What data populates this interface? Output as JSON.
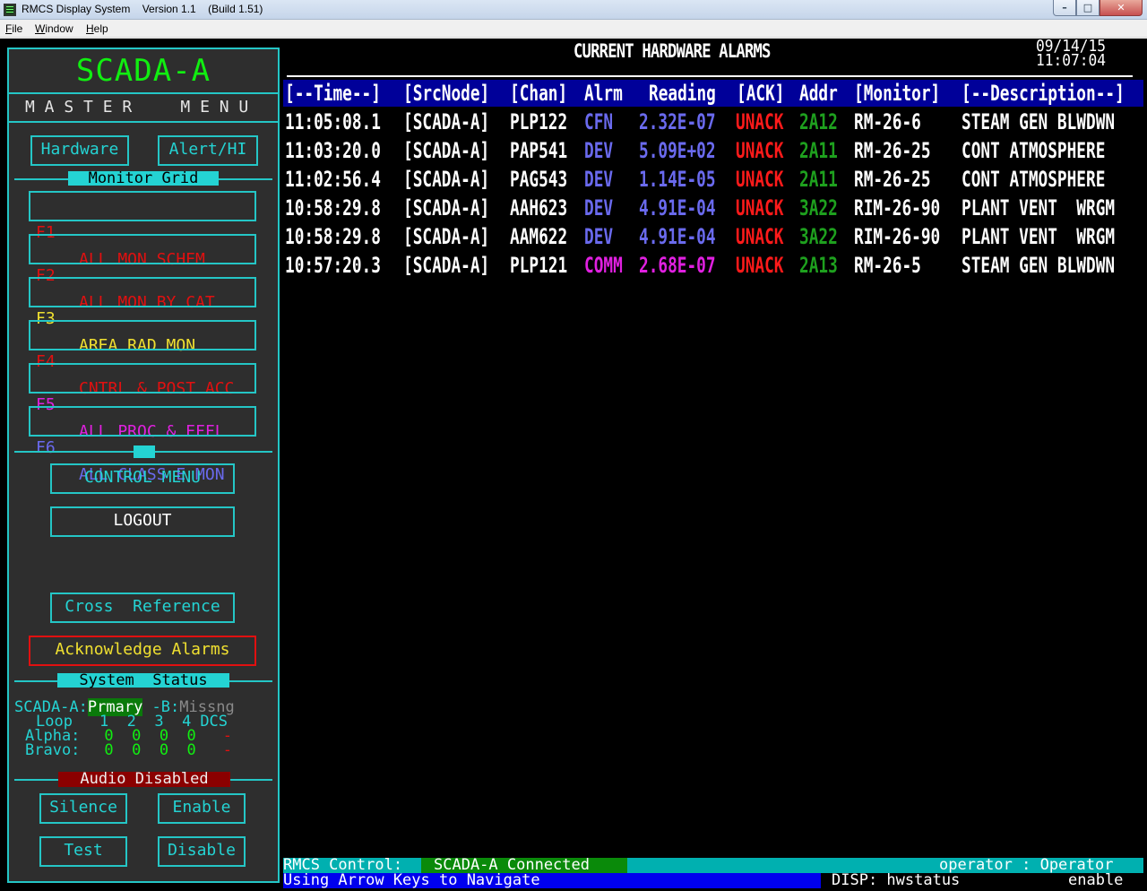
{
  "window": {
    "title": "RMCS Display System    Version 1.1    (Build 1.51)",
    "minimize": "–",
    "maximize": "□",
    "close": "✕"
  },
  "menubar": {
    "file": {
      "hot": "F",
      "rest": "ile"
    },
    "window": {
      "hot": "W",
      "rest": "indow"
    },
    "help": {
      "hot": "H",
      "rest": "elp"
    }
  },
  "panel": {
    "title": "SCADA-A",
    "master_menu": "M A S T E R     M E N U",
    "hardware": "Hardware",
    "alert_hi": "Alert/HI",
    "monitor_grid": "Monitor Grid",
    "fkeys": [
      {
        "key": "F1",
        "label": "ALL MON SCHEM",
        "color": "#e11010"
      },
      {
        "key": "F2",
        "label": "ALL MON BY CAT",
        "color": "#e11010"
      },
      {
        "key": "F3",
        "label": "AREA RAD MON",
        "color": "#f0e030"
      },
      {
        "key": "F4",
        "label": "CNTRL & POST ACC",
        "color": "#e11010"
      },
      {
        "key": "F5",
        "label": "ALL PROC & EFFL",
        "color": "#e020e0"
      },
      {
        "key": "F6",
        "label": "ALL CLASS E MON",
        "color": "#6a6aee"
      }
    ],
    "control_menu": "CONTROL MENU",
    "logout": "LOGOUT",
    "cross_reference": "Cross  Reference",
    "acknowledge_alarms": "Acknowledge Alarms",
    "system_status": "System  Status",
    "status": {
      "scada_a_label": "SCADA-A:",
      "scada_a_value": "Prmary",
      "scada_b_label": " -B:",
      "scada_b_value": "Missng",
      "loop_label": "Loop",
      "loop_cols": "1  2  3  4",
      "dcs_label": "DCS",
      "alpha_label": "Alpha:",
      "alpha_values": "0  0  0  0",
      "alpha_dcs": "-",
      "bravo_label": "Bravo:",
      "bravo_values": "0  0  0  0",
      "bravo_dcs": "-"
    },
    "audio": "Audio Disabled",
    "silence": "Silence",
    "enable": "Enable",
    "test": "Test",
    "disable": "Disable"
  },
  "alarms": {
    "title": "CURRENT HARDWARE ALARMS",
    "date": "09/14/15",
    "time": "11:07:04",
    "columns": [
      "[--Time--]",
      "[SrcNode]",
      "[Chan]",
      "Alrm",
      "Reading",
      "[ACK]",
      "Addr",
      "[Monitor]",
      "[--Description--]"
    ],
    "rows": [
      {
        "time": "11:05:08.1",
        "node": "[SCADA-A]",
        "chan": "PLP122",
        "alrm": "CFN",
        "reading": "2.32E-07",
        "ack": "UNACK",
        "addr": "2A12",
        "monitor": "RM-26-6",
        "desc": "STEAM GEN BLWDWN",
        "alrm_color": "#6a6aee",
        "reading_color": "#6a6aee"
      },
      {
        "time": "11:03:20.0",
        "node": "[SCADA-A]",
        "chan": "PAP541",
        "alrm": "DEV",
        "reading": "5.09E+02",
        "ack": "UNACK",
        "addr": "2A11",
        "monitor": "RM-26-25",
        "desc": "CONT ATMOSPHERE",
        "alrm_color": "#6a6aee",
        "reading_color": "#6a6aee"
      },
      {
        "time": "11:02:56.4",
        "node": "[SCADA-A]",
        "chan": "PAG543",
        "alrm": "DEV",
        "reading": "1.14E-05",
        "ack": "UNACK",
        "addr": "2A11",
        "monitor": "RM-26-25",
        "desc": "CONT ATMOSPHERE",
        "alrm_color": "#6a6aee",
        "reading_color": "#6a6aee"
      },
      {
        "time": "10:58:29.8",
        "node": "[SCADA-A]",
        "chan": "AAH623",
        "alrm": "DEV",
        "reading": "4.91E-04",
        "ack": "UNACK",
        "addr": "3A22",
        "monitor": "RIM-26-90",
        "desc": "PLANT VENT  WRGM",
        "alrm_color": "#6a6aee",
        "reading_color": "#6a6aee"
      },
      {
        "time": "10:58:29.8",
        "node": "[SCADA-A]",
        "chan": "AAM622",
        "alrm": "DEV",
        "reading": "4.91E-04",
        "ack": "UNACK",
        "addr": "3A22",
        "monitor": "RIM-26-90",
        "desc": "PLANT VENT  WRGM",
        "alrm_color": "#6a6aee",
        "reading_color": "#6a6aee"
      },
      {
        "time": "10:57:20.3",
        "node": "[SCADA-A]",
        "chan": "PLP121",
        "alrm": "COMM",
        "reading": "2.68E-07",
        "ack": "UNACK",
        "addr": "2A13",
        "monitor": "RM-26-5",
        "desc": "STEAM GEN BLWDWN",
        "alrm_color": "#e020e0",
        "reading_color": "#e020e0"
      }
    ]
  },
  "statusbar": {
    "control_label": "RMCS Control:",
    "connection": "SCADA-A Connected",
    "user": "operator : Operator",
    "nav_hint": "Using Arrow Keys to Navigate",
    "disp": "DISP: hwstatus",
    "mode": "enable"
  },
  "colors": {
    "cyan": "#24d3d3",
    "green": "#11ee11",
    "red": "#e11010",
    "ack_red": "#ff1a1a",
    "addr_green": "#1ea01e",
    "header_blue": "#000099"
  }
}
